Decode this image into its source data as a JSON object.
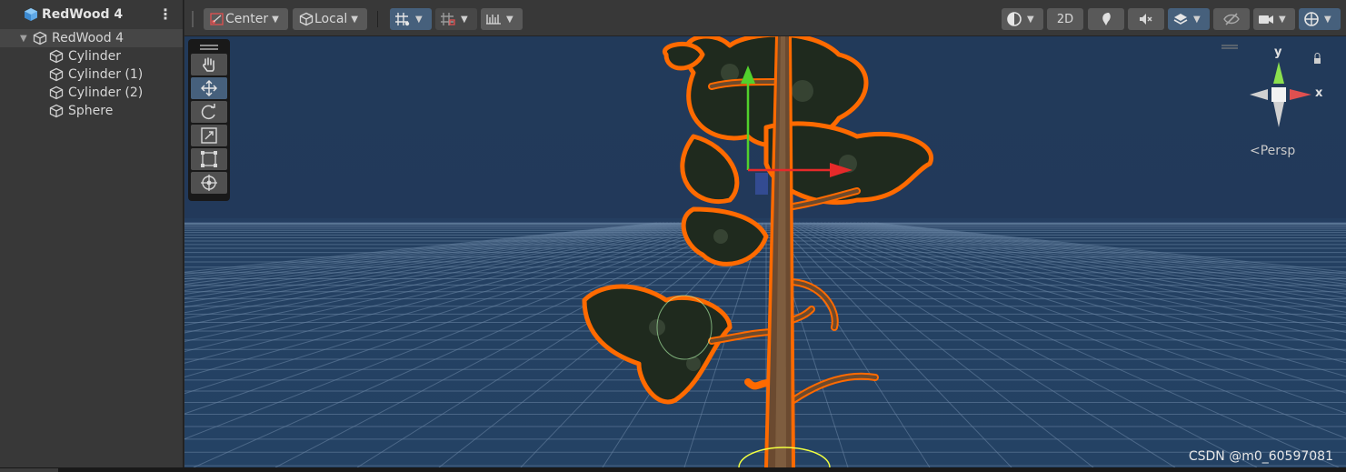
{
  "hierarchy": {
    "scene_name": "RedWood 4",
    "root": {
      "label": "RedWood 4"
    },
    "children": [
      {
        "label": "Cylinder"
      },
      {
        "label": "Cylinder (1)"
      },
      {
        "label": "Cylinder (2)"
      },
      {
        "label": "Sphere"
      }
    ]
  },
  "toolbar": {
    "pivot_label": "Center",
    "space_label": "Local",
    "mode_2d_label": "2D"
  },
  "scene_view": {
    "projection_label": "Persp",
    "axis_y": "y",
    "axis_x": "x",
    "active_tool": "move-tool"
  },
  "watermark": "CSDN @m0_60597081",
  "colors": {
    "accent": "#46607c",
    "selection_outline": "#ff6a00",
    "sky": "#223a5a"
  }
}
